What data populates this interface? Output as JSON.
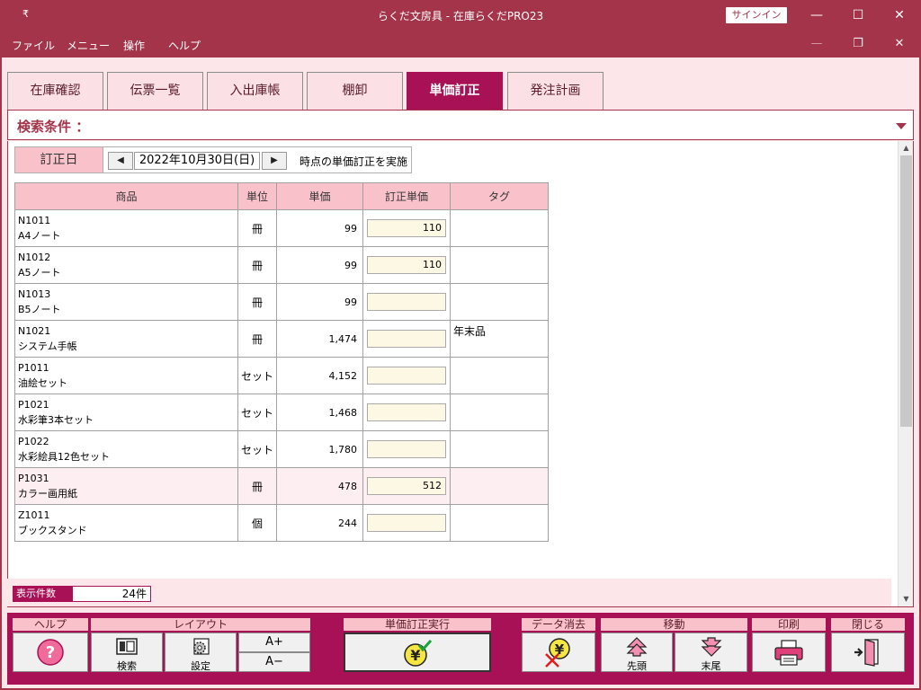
{
  "window": {
    "title": "らくだ文房具  -  在庫らくだPRO23",
    "signin_label": "サインイン"
  },
  "menu": [
    "ファイル",
    "メニュー",
    "操作",
    "ヘルプ"
  ],
  "tabs": [
    {
      "label": "在庫確認"
    },
    {
      "label": "伝票一覧"
    },
    {
      "label": "入出庫帳"
    },
    {
      "label": "棚卸"
    },
    {
      "label": "単価訂正",
      "active": true
    },
    {
      "label": "発注計画"
    }
  ],
  "search": {
    "label": "検索条件 ："
  },
  "date": {
    "label": "訂正日",
    "value": "2022年10月30日(日)",
    "suffix": "時点の単価訂正を実施"
  },
  "table": {
    "headers": [
      "商品",
      "単位",
      "単価",
      "訂正単価",
      "タグ"
    ],
    "rows": [
      {
        "code": "N1011",
        "name": "A4ノート",
        "unit": "冊",
        "price": "99",
        "corrected": "110",
        "tag": ""
      },
      {
        "code": "N1012",
        "name": "A5ノート",
        "unit": "冊",
        "price": "99",
        "corrected": "110",
        "tag": ""
      },
      {
        "code": "N1013",
        "name": "B5ノート",
        "unit": "冊",
        "price": "99",
        "corrected": "",
        "tag": ""
      },
      {
        "code": "N1021",
        "name": "システム手帳",
        "unit": "冊",
        "price": "1,474",
        "corrected": "",
        "tag": "年末品"
      },
      {
        "code": "P1011",
        "name": "油絵セット",
        "unit": "セット",
        "price": "4,152",
        "corrected": "",
        "tag": ""
      },
      {
        "code": "P1021",
        "name": "水彩筆3本セット",
        "unit": "セット",
        "price": "1,468",
        "corrected": "",
        "tag": ""
      },
      {
        "code": "P1022",
        "name": "水彩絵具12色セット",
        "unit": "セット",
        "price": "1,780",
        "corrected": "",
        "tag": ""
      },
      {
        "code": "P1031",
        "name": "カラー画用紙",
        "unit": "冊",
        "price": "478",
        "corrected": "512",
        "tag": "",
        "highlight": true
      },
      {
        "code": "Z1011",
        "name": "ブックスタンド",
        "unit": "個",
        "price": "244",
        "corrected": "",
        "tag": ""
      }
    ]
  },
  "count": {
    "label": "表示件数",
    "value": "24件"
  },
  "toolbar": {
    "help": {
      "header": "ヘルプ"
    },
    "layout": {
      "header": "レイアウト",
      "search": "検索",
      "settings": "設定",
      "font_up": "A+",
      "font_down": "A−"
    },
    "execute": {
      "header": "単価訂正実行"
    },
    "clear": {
      "header": "データ消去"
    },
    "move": {
      "header": "移動",
      "first": "先頭",
      "last": "末尾"
    },
    "print": {
      "header": "印刷"
    },
    "close": {
      "header": "閉じる"
    }
  },
  "colors": {
    "accent": "#a81155",
    "titlebar": "#a3344a",
    "pink": "#f9c2cb",
    "background": "#fde6ea"
  }
}
